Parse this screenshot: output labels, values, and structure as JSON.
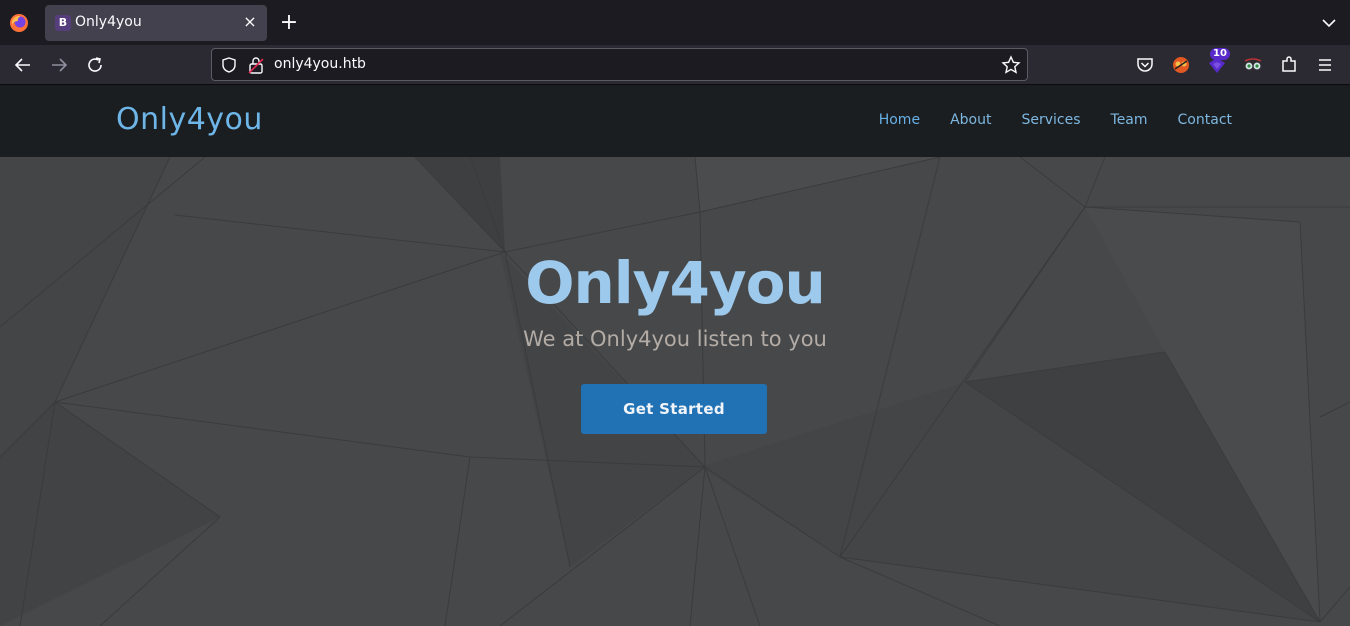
{
  "browser": {
    "tab": {
      "favicon_letter": "B",
      "title": "Only4you"
    },
    "url": "only4you.htb",
    "extension_badge": "10"
  },
  "site": {
    "logo": "Only4you",
    "nav": [
      {
        "label": "Home"
      },
      {
        "label": "About"
      },
      {
        "label": "Services"
      },
      {
        "label": "Team"
      },
      {
        "label": "Contact"
      }
    ],
    "hero": {
      "title": "Only4you",
      "subtitle": "We at Only4you listen to you",
      "cta_label": "Get Started"
    }
  },
  "colors": {
    "accent": "#6eb5e8",
    "cta": "#2171b5",
    "header_bg": "#1b1e21",
    "hero_bg": "#47484a"
  }
}
